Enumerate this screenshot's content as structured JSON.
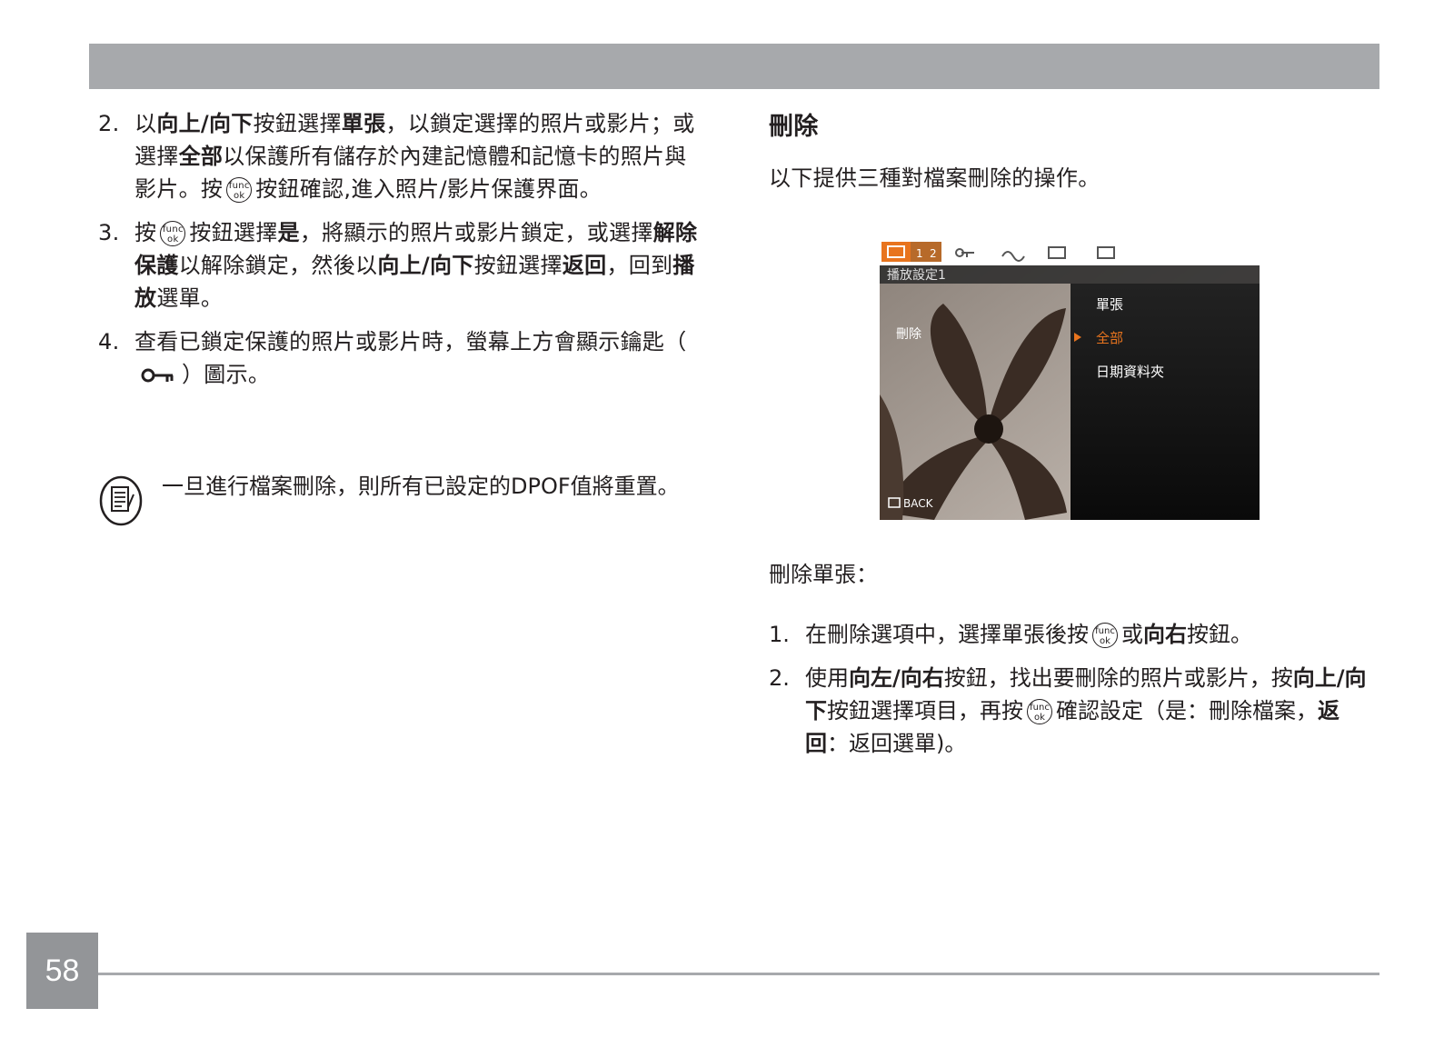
{
  "page_number": "58",
  "left": {
    "step2": {
      "num": "2.",
      "t1": "以",
      "b1": "向上/向下",
      "t2": "按鈕選擇",
      "b2": "單張",
      "t3": "，以鎖定選擇的照片或影片；或選擇",
      "b3": "全部",
      "t4": "以保護所有儲存於內建記憶體和記憶卡的照片與影片。按",
      "t5": "按鈕確認,進入照片/影片保護界面。"
    },
    "step3": {
      "num": "3.",
      "t1": "按",
      "t2": "按鈕選擇",
      "b1": "是",
      "t3": "，將顯示的照片或影片鎖定，或選擇",
      "b2": "解除保護",
      "t4": "以解除鎖定，然後以",
      "b3": "向上/向下",
      "t5": "按鈕選擇",
      "b4": "返回",
      "t6": "，回到",
      "b5": "播放",
      "t7": "選單。"
    },
    "step4": {
      "num": "4.",
      "t1": "查看已鎖定保護的照片或影片時，螢幕上方會顯示鑰匙（",
      "t2": "）圖示。"
    },
    "note": "一旦進行檔案刪除，則所有已設定的DPOF值將重置。"
  },
  "func_icon": {
    "top": "func",
    "bottom": "ok"
  },
  "right": {
    "title": "刪除",
    "intro": "以下提供三種對檔案刪除的操作。",
    "camera": {
      "tab_label": "播放設定1",
      "menu_label": "刪除",
      "options": [
        "單張",
        "全部",
        "日期資料夾"
      ],
      "selected_index": 1,
      "back_label": "BACK"
    },
    "sub_title": "刪除單張：",
    "step1": {
      "num": "1.",
      "t1": "在刪除選項中，選擇單張後按",
      "t2": "或",
      "b1": "向右",
      "t3": "按鈕。"
    },
    "step2": {
      "num": "2.",
      "t1": "使用",
      "b1": "向左/向右",
      "t2": "按鈕，找出要刪除的照片或影片，按",
      "b2": "向上/向下",
      "t3": "按鈕選擇項目，再按",
      "t4": "確認設定（是：刪除檔案，",
      "b3": "返回",
      "t5": "：返回選單)。"
    }
  },
  "colors": {
    "header_bar": "#a7a9ac",
    "page_box": "#939598",
    "highlight": "#e8741e"
  }
}
